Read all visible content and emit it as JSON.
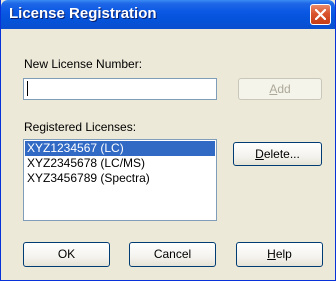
{
  "window": {
    "title": "License Registration"
  },
  "new_license": {
    "label": "New License Number:",
    "value": "",
    "add_button": "Add"
  },
  "registered": {
    "label": "Registered Licenses:",
    "items": [
      {
        "text": "XYZ1234567 (LC)",
        "selected": true
      },
      {
        "text": "XYZ2345678 (LC/MS)",
        "selected": false
      },
      {
        "text": "XYZ3456789 (Spectra)",
        "selected": false
      }
    ],
    "delete_button": "Delete..."
  },
  "footer": {
    "ok_button": "OK",
    "cancel_button": "Cancel",
    "help_button": "Help"
  },
  "colors": {
    "titlebar": "#0553d9",
    "selection": "#316ac5",
    "dialog_bg": "#ece9d8",
    "close_button": "#d9542c"
  }
}
